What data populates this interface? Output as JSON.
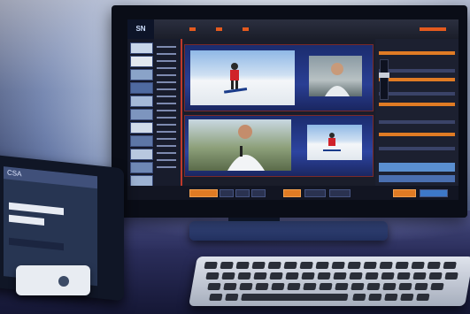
{
  "scene": {
    "description_labels": {
      "monitor_logo": "SN",
      "tablet_header": "CSA"
    },
    "colors": {
      "accent_orange": "#e07b24",
      "accent_red": "#c0392b",
      "ui_dark": "#1a1d2a",
      "desk_blue": "#2a2d5a"
    },
    "icons": [
      "monitor",
      "tablet",
      "keyboard",
      "video-preview",
      "fader"
    ]
  }
}
